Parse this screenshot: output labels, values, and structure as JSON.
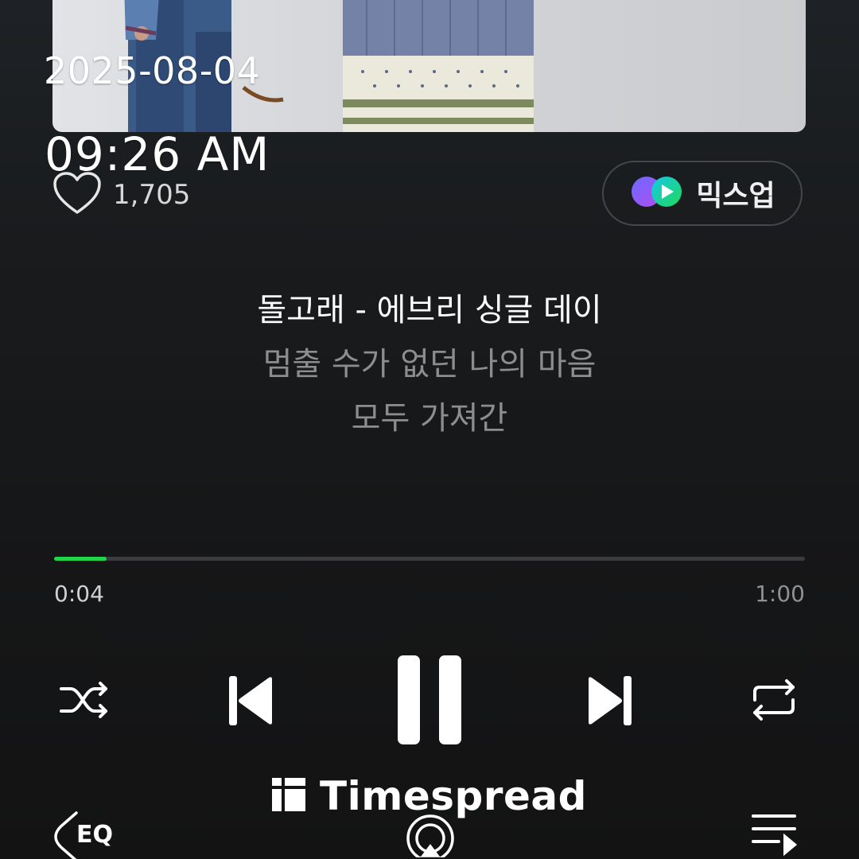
{
  "overlay": {
    "date": "2025-08-04",
    "time": "09:26 AM"
  },
  "like": {
    "count": "1,705",
    "icon": "heart-outline-icon"
  },
  "mixup": {
    "label": "믹스업",
    "icon": "mixup-play-icon"
  },
  "lyrics": {
    "title_line": "돌고래 - 에브리 싱글 데이",
    "lines": [
      "멈출 수가 없던 나의 마음",
      "모두 가져간"
    ]
  },
  "progress": {
    "current": "0:04",
    "total": "1:00",
    "fraction": 0.07
  },
  "controls": {
    "shuffle": "shuffle-icon",
    "previous": "skip-previous-icon",
    "pause": "pause-icon",
    "next": "skip-next-icon",
    "repeat": "repeat-icon"
  },
  "bottom": {
    "eq_label": "EQ",
    "cast": "cast-icon",
    "playlist": "playlist-icon"
  },
  "watermark": {
    "text": "Timespread"
  },
  "colors": {
    "accent": "#21d44a",
    "background": "#161718",
    "dim_text": "#8b8d8f"
  }
}
